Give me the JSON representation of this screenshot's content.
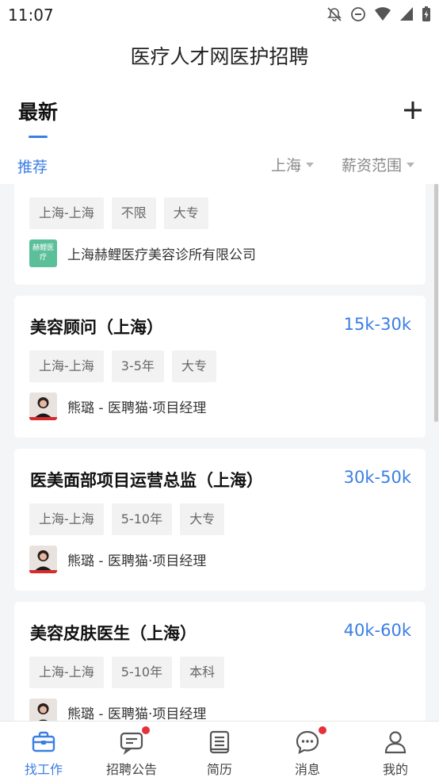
{
  "status": {
    "time": "11:07"
  },
  "app": {
    "title": "医疗人才网医护招聘"
  },
  "header": {
    "section_title": "最新"
  },
  "filters": {
    "recommend": "推荐",
    "city": "上海",
    "salary": "薪资范围"
  },
  "jobs": [
    {
      "title": "",
      "salary": "",
      "tags": [
        "上海-上海",
        "不限",
        "大专"
      ],
      "meta": "上海赫鲤医疗美容诊所有限公司",
      "logo_text": "赫鲤医疗"
    },
    {
      "title": "美容顾问（上海）",
      "salary": "15k-30k",
      "tags": [
        "上海-上海",
        "3-5年",
        "大专"
      ],
      "meta": "熊璐 - 医聘猫·项目经理"
    },
    {
      "title": "医美面部项目运营总监（上海）",
      "salary": "30k-50k",
      "tags": [
        "上海-上海",
        "5-10年",
        "大专"
      ],
      "meta": "熊璐 - 医聘猫·项目经理"
    },
    {
      "title": "美容皮肤医生（上海）",
      "salary": "40k-60k",
      "tags": [
        "上海-上海",
        "5-10年",
        "本科"
      ],
      "meta": "熊璐 - 医聘猫·项目经理"
    }
  ],
  "nav": [
    {
      "label": "找工作",
      "icon": "briefcase-icon",
      "active": true,
      "badge": false
    },
    {
      "label": "招聘公告",
      "icon": "message-square-icon",
      "active": false,
      "badge": true
    },
    {
      "label": "简历",
      "icon": "document-icon",
      "active": false,
      "badge": false
    },
    {
      "label": "消息",
      "icon": "chat-bubble-icon",
      "active": false,
      "badge": true
    },
    {
      "label": "我的",
      "icon": "user-icon",
      "active": false,
      "badge": false
    }
  ],
  "colors": {
    "accent": "#3a7ee4",
    "badge": "#e5323a",
    "background": "#f4f5f7"
  }
}
